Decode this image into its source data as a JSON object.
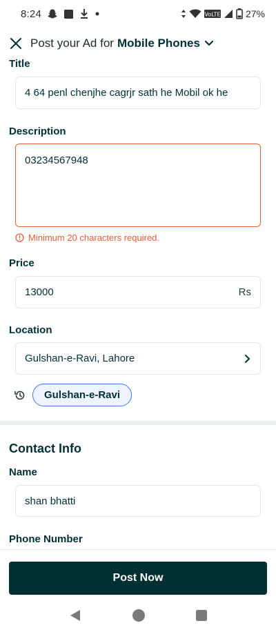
{
  "status_bar": {
    "time": "8:24",
    "battery": "27%",
    "network_badge": "VoLTE"
  },
  "header": {
    "title_prefix": "Post your Ad for",
    "category": "Mobile Phones"
  },
  "form": {
    "title": {
      "label": "Title",
      "value": "4 64 penl chenjhe cagrjr sath he Mobil ok he"
    },
    "description": {
      "label": "Description",
      "value": "03234567948",
      "error": "Minimum 20 characters required."
    },
    "price": {
      "label": "Price",
      "value": "13000",
      "currency": "Rs"
    },
    "location": {
      "label": "Location",
      "value": "Gulshan-e-Ravi, Lahore",
      "recent_chip": "Gulshan-e-Ravi"
    }
  },
  "contact": {
    "section_title": "Contact Info",
    "name": {
      "label": "Name",
      "value": "shan bhatti"
    },
    "phone": {
      "label": "Phone Number"
    }
  },
  "footer": {
    "post_button": "Post Now"
  },
  "colors": {
    "primary": "#002f34",
    "error": "#e35d3a",
    "chip_border": "#3a77ff",
    "chip_bg": "#edf4ff"
  }
}
